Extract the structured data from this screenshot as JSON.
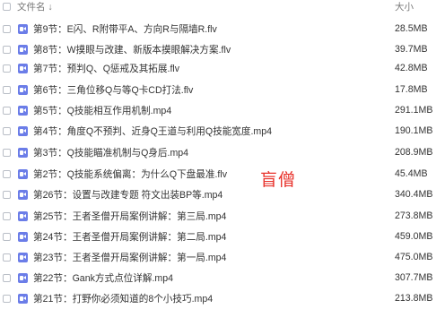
{
  "header": {
    "name_label": "文件名",
    "sort_indicator": "↓",
    "size_label": "大小"
  },
  "files": [
    {
      "name": "第9节：E闪、R附带平A、方向R与隔墙R.flv",
      "size": "28.5MB"
    },
    {
      "name": "第8节：W摸眼与改建、新版本摸眼解决方案.flv",
      "size": "39.7MB"
    },
    {
      "name": "第7节：预判Q、Q惩戒及其拓展.flv",
      "size": "42.8MB"
    },
    {
      "name": "第6节：三角位移Q与等Q卡CD打法.flv",
      "size": "17.8MB"
    },
    {
      "name": "第5节：Q技能相互作用机制.mp4",
      "size": "291.1MB"
    },
    {
      "name": "第4节：角度Q不预判、近身Q王道与利用Q技能宽度.mp4",
      "size": "190.1MB"
    },
    {
      "name": "第3节：Q技能瞄准机制与Q身后.mp4",
      "size": "208.9MB"
    },
    {
      "name": "第2节：Q技能系统偏离：为什么Q下盘最准.flv",
      "size": "45.4MB"
    },
    {
      "name": "第26节：设置与改建专题 符文出装BP等.mp4",
      "size": "340.4MB"
    },
    {
      "name": "第25节：王者圣僧开局案例讲解：第三局.mp4",
      "size": "273.8MB"
    },
    {
      "name": "第24节：王者圣僧开局案例讲解：第二局.mp4",
      "size": "459.0MB"
    },
    {
      "name": "第23节：王者圣僧开局案例讲解：第一局.mp4",
      "size": "475.0MB"
    },
    {
      "name": "第22节：Gank方式点位详解.mp4",
      "size": "307.7MB"
    },
    {
      "name": "第21节：打野你必须知道的8个小技巧.mp4",
      "size": "213.8MB"
    }
  ],
  "watermark": "盲僧",
  "colors": {
    "watermark": "#e8322b",
    "file_icon": "#6b7de8",
    "header_text": "#777777"
  },
  "icons": {
    "file_icon": "video-file-icon",
    "checkbox": "checkbox"
  }
}
